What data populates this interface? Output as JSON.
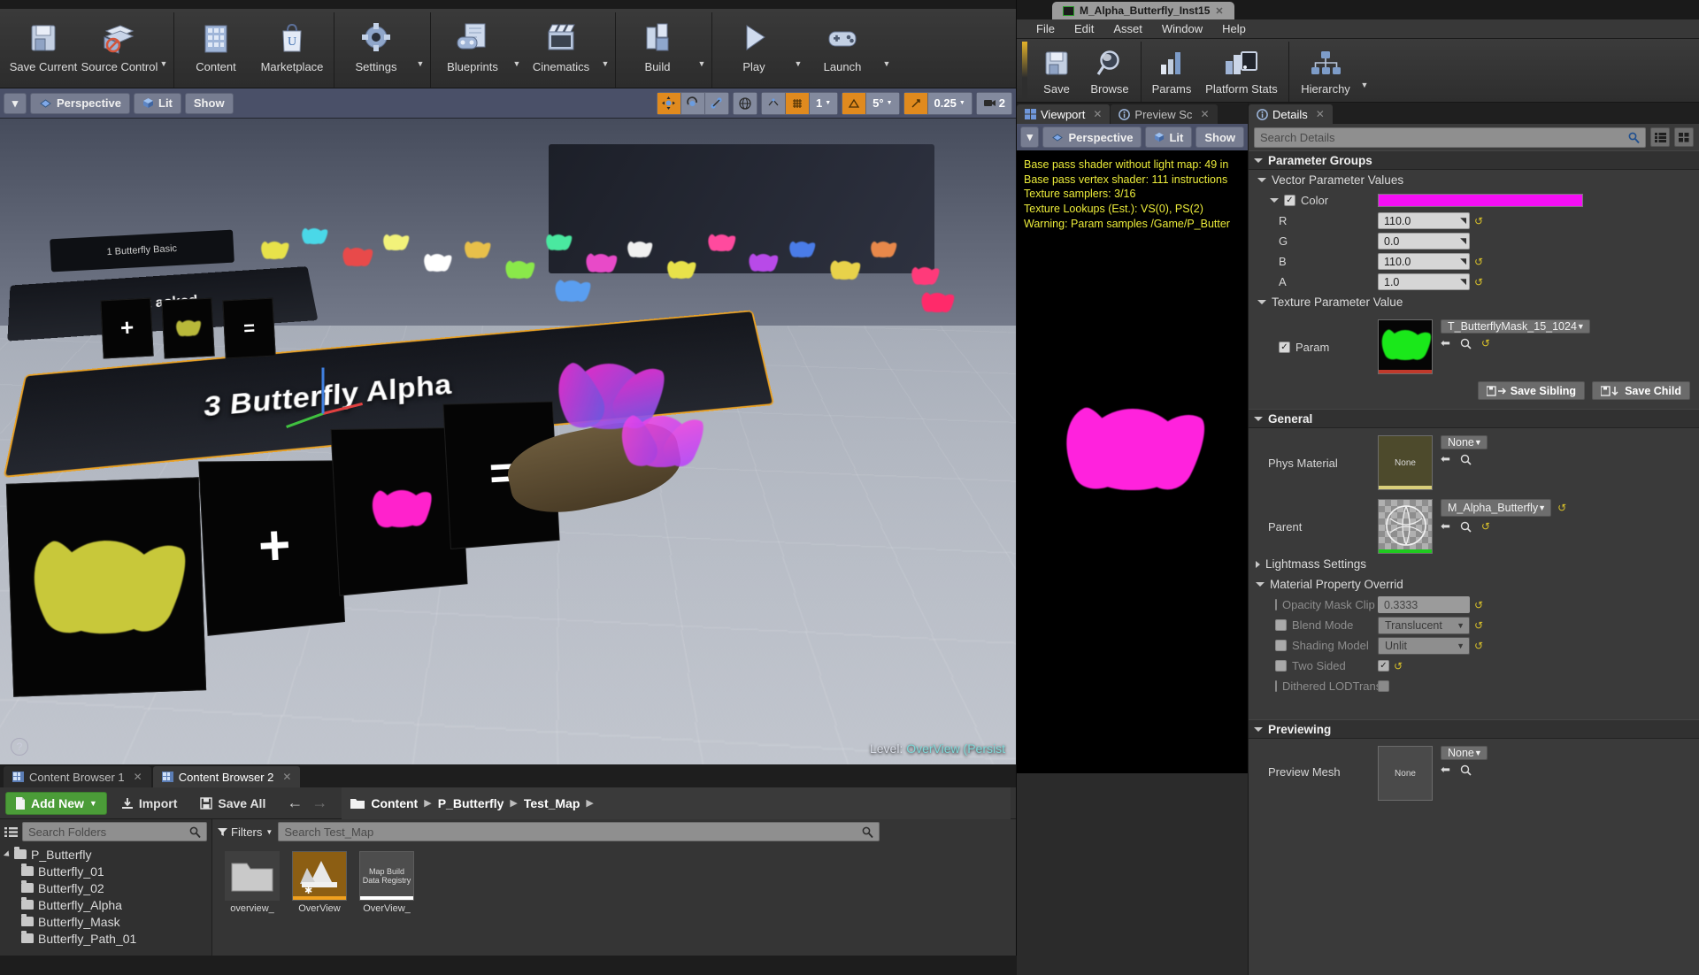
{
  "main_toolbar": {
    "groups": [
      {
        "buttons": [
          {
            "label": "Save Current",
            "icon": "floppy-disk-icon",
            "caret": false
          },
          {
            "label": "Source Control",
            "icon": "source-control-icon",
            "caret": true
          }
        ]
      },
      {
        "buttons": [
          {
            "label": "Content",
            "icon": "content-browser-icon",
            "caret": false
          },
          {
            "label": "Marketplace",
            "icon": "marketplace-bag-icon",
            "caret": false
          }
        ]
      },
      {
        "buttons": [
          {
            "label": "Settings",
            "icon": "gear-icon",
            "caret": true
          }
        ]
      },
      {
        "buttons": [
          {
            "label": "Blueprints",
            "icon": "blueprint-icon",
            "caret": true
          },
          {
            "label": "Cinematics",
            "icon": "clapperboard-icon",
            "caret": true
          }
        ]
      },
      {
        "buttons": [
          {
            "label": "Build",
            "icon": "build-blocks-icon",
            "caret": true
          }
        ]
      },
      {
        "buttons": [
          {
            "label": "Play",
            "icon": "play-triangle-icon",
            "caret": true
          },
          {
            "label": "Launch",
            "icon": "gamepad-icon",
            "caret": true
          }
        ]
      }
    ]
  },
  "viewport_bar": {
    "menu_caret": "▾",
    "perspective": "Perspective",
    "lit": "Lit",
    "show": "Show",
    "transform_tools": [
      "move-gizmo-icon",
      "rotate-gizmo-icon",
      "scale-gizmo-icon"
    ],
    "world_icon": "globe-icon",
    "surface_snap_icon": "surface-snap-icon",
    "grid_snap_icon": "grid-snap-icon",
    "grid_size": "1",
    "angle_icon": "angle-snap-icon",
    "angle_value": "5°",
    "scale_icon": "scale-snap-icon",
    "scale_value": "0.25",
    "camera_icon": "camera-speed-icon",
    "camera_value": "2"
  },
  "viewport": {
    "banner_main": "3  Butterfly Alpha",
    "banner_second": "But          asked",
    "banner_third": "1  Butterfly Basic",
    "level_label": "Level:",
    "level_name": "OverView (Persist",
    "help_icon": "question-mark-icon"
  },
  "content_browser": {
    "tabs": [
      {
        "label": "Content Browser 1",
        "active": false
      },
      {
        "label": "Content Browser 2",
        "active": true
      }
    ],
    "add_new": "Add New",
    "import": "Import",
    "save_all": "Save All",
    "back_icon": "arrow-left-icon",
    "forward_icon": "arrow-right-icon",
    "breadcrumbs": [
      "Content",
      "P_Butterfly",
      "Test_Map"
    ],
    "search_folders_placeholder": "Search Folders",
    "filters_label": "Filters",
    "search_assets_placeholder": "Search Test_Map",
    "tree": [
      {
        "label": "P_Butterfly",
        "depth": 0,
        "expanded": true
      },
      {
        "label": "Butterfly_01",
        "depth": 1,
        "expanded": false
      },
      {
        "label": "Butterfly_02",
        "depth": 1,
        "expanded": false
      },
      {
        "label": "Butterfly_Alpha",
        "depth": 1,
        "expanded": false
      },
      {
        "label": "Butterfly_Mask",
        "depth": 1,
        "expanded": false
      },
      {
        "label": "Butterfly_Path_01",
        "depth": 1,
        "expanded": false
      }
    ],
    "assets": [
      {
        "name": "overview_",
        "type": "folder",
        "thumb_text": ""
      },
      {
        "name": "OverView",
        "type": "level",
        "thumb_text": ""
      },
      {
        "name": "OverView_",
        "type": "data",
        "thumb_text": "Map Build Data Registry"
      }
    ]
  },
  "material_editor": {
    "tab_title": "M_Alpha_Butterfly_Inst15",
    "menus": [
      "File",
      "Edit",
      "Asset",
      "Window",
      "Help"
    ],
    "toolbar": [
      {
        "label": "Save",
        "icon": "floppy-disk-icon",
        "caret": false
      },
      {
        "label": "Browse",
        "icon": "magnifier-icon",
        "caret": false
      },
      {
        "label": "Params",
        "icon": "params-bars-icon",
        "caret": false
      },
      {
        "label": "Platform Stats",
        "icon": "platform-stats-icon",
        "caret": false
      },
      {
        "label": "Hierarchy",
        "icon": "hierarchy-tree-icon",
        "caret": true
      }
    ],
    "left_tabs": [
      {
        "label": "Viewport",
        "icon": "viewport-grid-icon",
        "active": true
      },
      {
        "label": "Preview Sc",
        "icon": "info-circle-icon",
        "active": false
      }
    ],
    "preview_bar": {
      "menu_caret": "▾",
      "perspective": "Perspective",
      "lit": "Lit",
      "show": "Show"
    },
    "stats": [
      "Base pass shader without light map: 49 in",
      "Base pass vertex shader: 111 instructions",
      "Texture samplers: 3/16",
      "Texture Lookups (Est.): VS(0), PS(2)",
      "Warning: Param samples /Game/P_Butter"
    ],
    "details_tab": {
      "label": "Details",
      "icon": "info-circle-icon"
    },
    "search_placeholder": "Search Details",
    "view_icons": [
      "list-view-icon",
      "grid-view-icon"
    ],
    "categories": {
      "parameter_groups": "Parameter Groups",
      "vector_parameter_values": "Vector Parameter Values",
      "texture_parameter_value": "Texture Parameter Value",
      "general": "General",
      "lightmass_settings": "Lightmass Settings",
      "material_property_overrides": "Material Property Overrid",
      "previewing": "Previewing"
    },
    "color_param": {
      "label": "Color",
      "checked": true,
      "swatch_hex": "#f50ef5",
      "channels": [
        {
          "label": "R",
          "value": "110.0"
        },
        {
          "label": "G",
          "value": "0.0"
        },
        {
          "label": "B",
          "value": "110.0"
        },
        {
          "label": "A",
          "value": "1.0"
        }
      ]
    },
    "texture_param": {
      "label": "Param",
      "checked": true,
      "value": "T_ButterflyMask_15_1024",
      "thumb_accent": "#c0392b"
    },
    "save_sibling": "Save Sibling",
    "save_child": "Save Child",
    "general": {
      "phys_material": {
        "label": "Phys Material",
        "value": "None",
        "thumb_label": "None",
        "accent": "#d9cf7a"
      },
      "parent": {
        "label": "Parent",
        "value": "M_Alpha_Butterfly",
        "accent": "#1fc91f"
      }
    },
    "property_overrides": [
      {
        "label": "Opacity Mask Clip V",
        "type": "number",
        "value": "0.3333",
        "checked": false,
        "revert": true
      },
      {
        "label": "Blend Mode",
        "type": "dropdown",
        "value": "Translucent",
        "checked": false,
        "revert": true
      },
      {
        "label": "Shading Model",
        "type": "dropdown",
        "value": "Unlit",
        "checked": false,
        "revert": true
      },
      {
        "label": "Two Sided",
        "type": "checkbox",
        "value": "✓",
        "checked": false,
        "revert": true
      },
      {
        "label": "Dithered LODTransit",
        "type": "blank",
        "value": "",
        "checked": false,
        "revert": false
      }
    ],
    "previewing": {
      "preview_mesh": {
        "label": "Preview Mesh",
        "value": "None",
        "thumb_label": "None"
      }
    }
  }
}
